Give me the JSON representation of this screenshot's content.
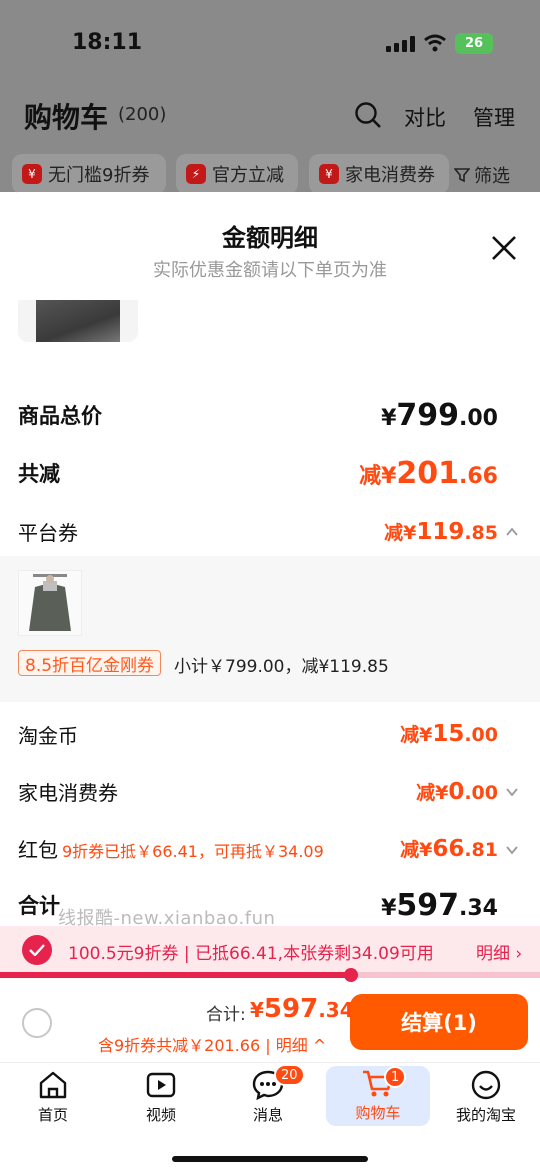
{
  "status_bar": {
    "time": "18:11",
    "battery": "26"
  },
  "header": {
    "title": "购物车",
    "count": "(200)",
    "compare": "对比",
    "manage": "管理"
  },
  "chips": [
    {
      "label": "无门槛9折券",
      "icon": "¥"
    },
    {
      "label": "官方立减",
      "icon": "⚡"
    },
    {
      "label": "家电消费券",
      "icon": "¥"
    }
  ],
  "filter_label": "筛选",
  "sheet": {
    "title": "金额明细",
    "subtitle": "实际优惠金额请以下单页为准"
  },
  "rows": {
    "goods_total": {
      "label": "商品总价",
      "symbol": "¥",
      "int": "799",
      "dec": ".00"
    },
    "discount_total": {
      "label": "共减",
      "prefix": "减",
      "symbol": "¥",
      "int": "201",
      "dec": ".66"
    },
    "platform_coupon": {
      "label": "平台券",
      "prefix": "减",
      "symbol": "¥",
      "int": "119",
      "dec": ".85"
    },
    "tjb": {
      "label": "淘金币",
      "prefix": "减",
      "symbol": "¥",
      "int": "15",
      "dec": ".00"
    },
    "appliance": {
      "label": "家电消费券",
      "prefix": "减",
      "symbol": "¥",
      "int": "0",
      "dec": ".00"
    },
    "hongbao": {
      "label": "红包",
      "note": "9折券已抵￥66.41，可再抵￥34.09",
      "prefix": "减",
      "symbol": "¥",
      "int": "66",
      "dec": ".81"
    },
    "sum": {
      "label": "合计",
      "symbol": "¥",
      "int": "597",
      "dec": ".34"
    }
  },
  "coupon_detail": {
    "tag": "8.5折百亿金刚券",
    "subtotal": "小计￥799.00，减¥119.85"
  },
  "watermark": "线报酷-new.xianbao.fun",
  "selection_bar": {
    "text": "100.5元9折券 | 已抵66.41,本张券剩34.09可用",
    "link": "明细 ›",
    "progress": 0.65
  },
  "footer": {
    "total_label": "合计:",
    "total_symbol": "¥",
    "total_int": "597",
    "total_dec": ".34",
    "sub_text": "含9折券共减￥201.66 | 明细 ^",
    "checkout": "结算(1)"
  },
  "tabs": [
    {
      "label": "首页",
      "icon": "home-icon"
    },
    {
      "label": "视频",
      "icon": "video-icon"
    },
    {
      "label": "消息",
      "icon": "message-icon",
      "badge": "20"
    },
    {
      "label": "购物车",
      "icon": "cart-icon",
      "badge": "1",
      "active": true
    },
    {
      "label": "我的淘宝",
      "icon": "profile-icon"
    }
  ],
  "colors": {
    "accent": "#ff4a12",
    "checkout": "#ff5a00",
    "coupon_red": "#e6234d"
  }
}
